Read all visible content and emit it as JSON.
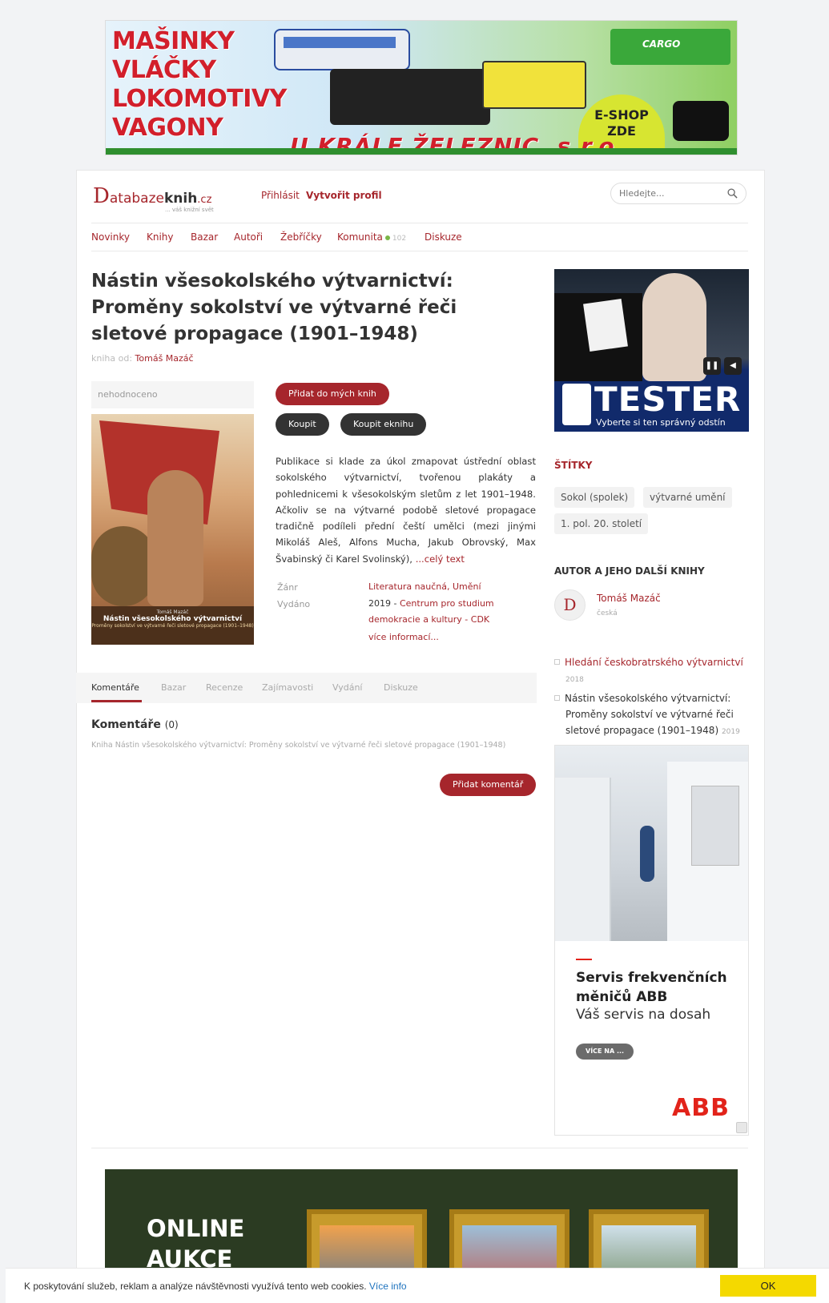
{
  "top_banner": {
    "lines": [
      "MAŠINKY",
      "VLÁČKY",
      "LOKOMOTIVY",
      "VAGONY"
    ],
    "bottom": "U KRÁLE ŽELEZNIC, s.r.o.",
    "eshop": [
      "E-SHOP",
      "ZDE"
    ],
    "cargo": "CARGO"
  },
  "header": {
    "logo": {
      "d": "D",
      "part1": "atabaze",
      "part2": "knih",
      "part3": ".cz",
      "tag": "... váš knižní svět"
    },
    "login": "Přihlásit",
    "register": "Vytvořit profil",
    "search_placeholder": "Hledejte..."
  },
  "nav": {
    "items": [
      "Novinky",
      "Knihy",
      "Bazar",
      "Autoři",
      "Žebříčky",
      "Komunita",
      "Diskuze"
    ],
    "community_count": "102"
  },
  "book": {
    "title": "Nástin všesokolského výtvarnictví: Proměny sokolství ve výtvarné řeči sletové propagace (1901–1948)",
    "author_prefix": "kniha od:",
    "author": "Tomáš Mazáč",
    "rating": "nehodnoceno",
    "cover": {
      "author": "Tomáš Mazáč",
      "title": "Nástin všesokolského výtvarnictví",
      "subtitle": "Proměny sokolství ve výtvarné řeči sletové propagace (1901–1948)"
    },
    "add_button": "Přidat do mých knih",
    "buy_button": "Koupit",
    "buy_ebook_button": "Koupit eknihu",
    "annotation": "Publikace si klade za úkol zmapovat ústřední oblast sokolského výtvarnictví, tvořenou plakáty a pohlednicemi k všesokolským sletům z let 1901–1948. Ačkoliv se na výtvarné podobě sletové propagace tradičně podíleli přední čeští umělci (mezi jinými Mikoláš Aleš, Alfons Mucha, Jakub Obrovský, Max Švabinský či Karel Svolinský), ",
    "more_text": "...celý text",
    "genre_label": "Žánr",
    "genre": "Literatura naučná, Umění",
    "published_label": "Vydáno",
    "published_year": "2019 - ",
    "publisher": "Centrum pro studium demokracie a kultury - CDK",
    "more_info": "více informací..."
  },
  "tabs": [
    "Komentáře",
    "Bazar",
    "Recenze",
    "Zajímavosti",
    "Vydání",
    "Diskuze"
  ],
  "comments": {
    "title": "Komentáře",
    "count": "(0)",
    "subtitle": "Kniha Nástin všesokolského výtvarnictví: Proměny sokolství ve výtvarné řeči sletové propagace (1901–1948)",
    "add_button": "Přidat komentář"
  },
  "sidebar": {
    "ad_tester": {
      "word": "TESTER",
      "sub": "Vyberte si ten správný odstín"
    },
    "tags_title": "ŠTÍTKY",
    "tags": [
      "Sokol (spolek)",
      "výtvarné umění",
      "1. pol. 20. století"
    ],
    "author_title": "AUTOR A JEHO DALŠÍ KNIHY",
    "author_initial": "D",
    "author_name": "Tomáš Mazáč",
    "author_nationality": "česká",
    "books": [
      {
        "title": "Hledání českobratrského výtvarnictví",
        "year": "2018"
      },
      {
        "title": "Nástin všesokolského výtvarnictví: Proměny sokolství ve výtvarné řeči sletové propagace (1901–1948)",
        "year": "2019"
      }
    ],
    "ad_abb": {
      "title": "Servis frekvenčních měničů ABB",
      "subtitle": "Váš servis na dosah",
      "cta": "VÍCE NA ...",
      "logo": "ABB"
    }
  },
  "bottom_ad": {
    "lines": [
      "ONLINE",
      "AUKCE"
    ]
  },
  "cookie": {
    "text": "K poskytování služeb, reklam a analýze návštěvnosti využívá tento web cookies. ",
    "link": "Více info",
    "ok": "OK"
  },
  "colors": {
    "brand": "#a6262c",
    "dark_button": "#333333",
    "cookie_ok": "#f4d900"
  }
}
